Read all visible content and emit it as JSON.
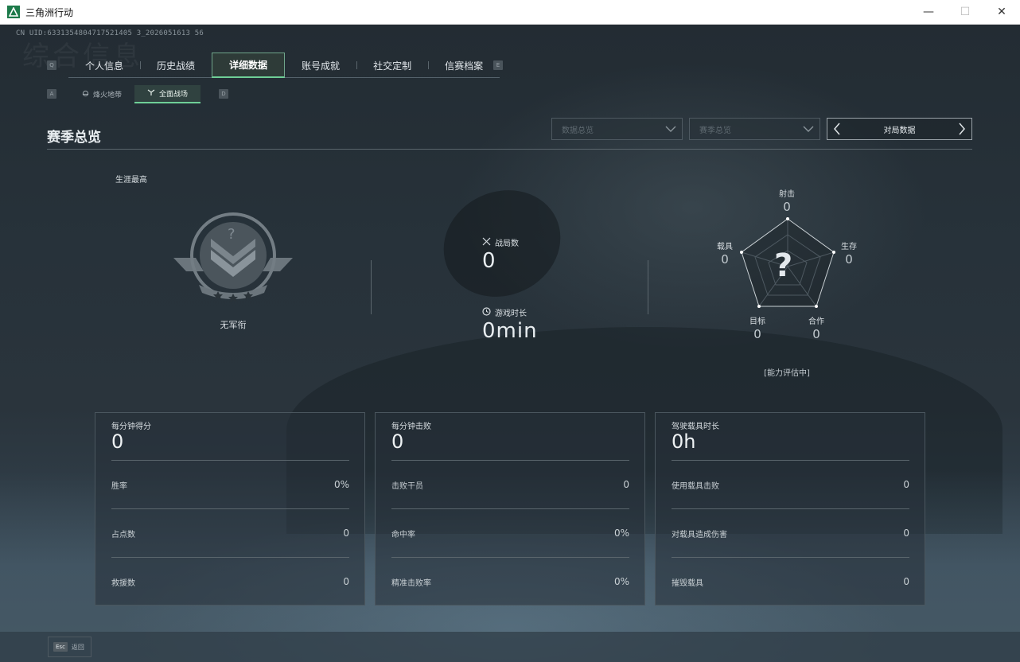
{
  "window": {
    "title": "三角洲行动",
    "min": "—",
    "max": "☐",
    "close": "✕"
  },
  "uid": "CN UID:6331354804717521405 3_2026051613 56",
  "ghost_title": "综合信息",
  "hint_keys": {
    "left": "Q",
    "right": "E",
    "sub_left": "A",
    "sub_right": "D"
  },
  "tabs": [
    "个人信息",
    "历史战绩",
    "详细数据",
    "账号成就",
    "社交定制",
    "信赛档案"
  ],
  "active_tab": "详细数据",
  "subtabs": [
    {
      "label": "烽火地带",
      "icon": "helmet-icon"
    },
    {
      "label": "全面战场",
      "icon": "tactical-icon",
      "active": true
    }
  ],
  "section": {
    "title": "赛季总览"
  },
  "filters": {
    "data_overview": "数据总览",
    "season_overview": "赛季总览",
    "match_data": "对局数据"
  },
  "career": {
    "label": "生涯最高",
    "rank": "无军衔",
    "emblem_glyph": "?"
  },
  "stats": {
    "matches_label": "战局数",
    "matches_value": "0",
    "playtime_label": "游戏时长",
    "playtime_value": "0min"
  },
  "radar": {
    "axes": [
      {
        "label": "射击",
        "value": "0"
      },
      {
        "label": "生存",
        "value": "0"
      },
      {
        "label": "合作",
        "value": "0"
      },
      {
        "label": "目标",
        "value": "0"
      },
      {
        "label": "载具",
        "value": "0"
      }
    ],
    "center_glyph": "?",
    "status": "[能力评估中]"
  },
  "cards": [
    {
      "title": "每分钟得分",
      "value": "0",
      "rows": [
        {
          "label": "胜率",
          "value": "0%"
        },
        {
          "label": "占点数",
          "value": "0"
        },
        {
          "label": "救援数",
          "value": "0"
        }
      ]
    },
    {
      "title": "每分钟击败",
      "value": "0",
      "rows": [
        {
          "label": "击败干员",
          "value": "0"
        },
        {
          "label": "命中率",
          "value": "0%"
        },
        {
          "label": "精准击败率",
          "value": "0%"
        }
      ]
    },
    {
      "title": "驾驶载具时长",
      "value": "0h",
      "rows": [
        {
          "label": "使用载具击败",
          "value": "0"
        },
        {
          "label": "对载具造成伤害",
          "value": "0"
        },
        {
          "label": "摧毁载具",
          "value": "0"
        }
      ]
    }
  ],
  "footer": {
    "esc_key": "Esc",
    "esc_label": "返回"
  },
  "colors": {
    "accent": "#6fcf97",
    "background": "#1e272e",
    "text": "#d8dee2"
  }
}
